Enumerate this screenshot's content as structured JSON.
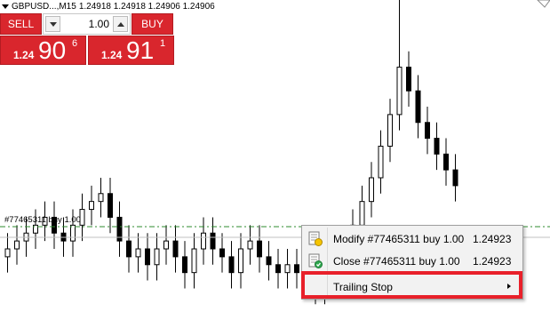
{
  "header": {
    "symbol": "GBPUSD...,M15",
    "ohlc": "1.24918 1.24918 1.24906 1.24906"
  },
  "one_click_trading": {
    "sell_label": "SELL",
    "buy_label": "BUY",
    "volume": "1.00",
    "sell_price": {
      "prefix": "1.24",
      "big": "90",
      "sup": "6"
    },
    "buy_price": {
      "prefix": "1.24",
      "big": "91",
      "sup": "1"
    }
  },
  "order_line": {
    "label": "#77465311 buy 1.00",
    "color": "#2e8b2e"
  },
  "context_menu": {
    "items": [
      {
        "label": "Modify #77465311 buy 1.00",
        "price": "1.24923",
        "icon": "modify-order-icon"
      },
      {
        "label": "Close #77465311 buy 1.00",
        "price": "1.24923",
        "icon": "close-order-icon"
      },
      {
        "label": "Trailing Stop",
        "price": "",
        "icon": "",
        "has_submenu": true
      }
    ],
    "highlight_color": "#e8202a"
  },
  "chart_data": {
    "type": "candlestick",
    "symbol": "GBPUSD",
    "timeframe": "M15",
    "candles_approx_close": [
      1.2483,
      1.2484,
      1.2485,
      1.2486,
      1.2487,
      1.2485,
      1.2484,
      1.2486,
      1.2488,
      1.2489,
      1.249,
      1.2487,
      1.2484,
      1.2482,
      1.2483,
      1.2481,
      1.2483,
      1.2484,
      1.2482,
      1.248,
      1.2483,
      1.2485,
      1.2483,
      1.2482,
      1.248,
      1.2483,
      1.2484,
      1.2482,
      1.2481,
      1.248,
      1.2481,
      1.248,
      1.2479,
      1.2478,
      1.248,
      1.2482,
      1.2484,
      1.2486,
      1.2489,
      1.2492,
      1.2496,
      1.25,
      1.2506,
      1.2503,
      1.2499,
      1.2497,
      1.2495,
      1.2493,
      1.2491
    ],
    "order_price": 1.24923
  }
}
